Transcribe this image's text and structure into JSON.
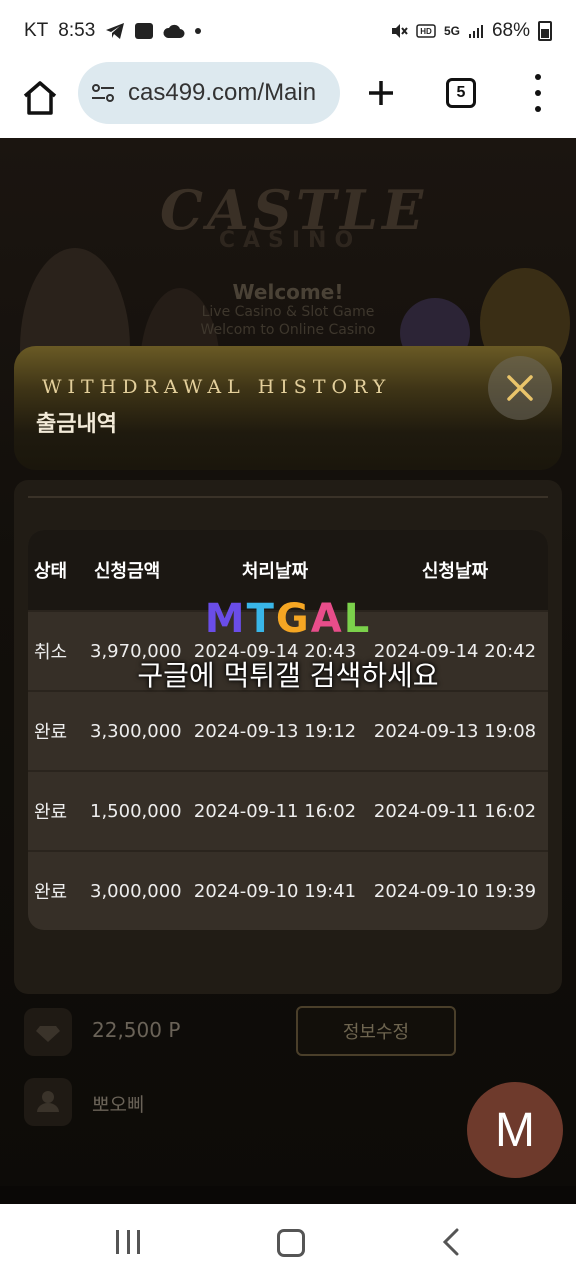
{
  "status_bar": {
    "carrier": "KT",
    "time": "8:53",
    "network": "5G",
    "battery": "68%"
  },
  "browser": {
    "url": "cas499.com/Main",
    "tab_count": "5"
  },
  "hero": {
    "logo": "CASTLE",
    "logo_sub": "CASINO",
    "welcome": "Welcome!",
    "line1": "Live Casino & Slot Game",
    "line2": "Welcom to Online Casino"
  },
  "modal": {
    "eyebrow": "WITHDRAWAL HISTORY",
    "title": "출금내역",
    "columns": [
      "상태",
      "신청금액",
      "처리날짜",
      "신청날짜"
    ],
    "rows": [
      {
        "status": "취소",
        "amount": "3,970,000",
        "processed": "2024-09-14 20:43",
        "requested": "2024-09-14 20:42"
      },
      {
        "status": "완료",
        "amount": "3,300,000",
        "processed": "2024-09-13 19:12",
        "requested": "2024-09-13 19:08"
      },
      {
        "status": "완료",
        "amount": "1,500,000",
        "processed": "2024-09-11 16:02",
        "requested": "2024-09-11 16:02"
      },
      {
        "status": "완료",
        "amount": "3,000,000",
        "processed": "2024-09-10 19:41",
        "requested": "2024-09-10 19:39"
      }
    ]
  },
  "watermark": {
    "logo_letters": [
      "M",
      "T",
      "G",
      "A",
      "L"
    ],
    "logo_colors": [
      "#6a4de8",
      "#39b6e8",
      "#f5a623",
      "#e84d8a",
      "#7bd14b"
    ],
    "text": "구글에 먹튀갤 검색하세요"
  },
  "account": {
    "points": "22,500 P",
    "username": "뽀오삐",
    "edit_label": "정보수정"
  },
  "fab": {
    "label": "M"
  },
  "colors": {
    "accent_gold": "#e3cf9b",
    "fab": "#6e3a2c"
  }
}
